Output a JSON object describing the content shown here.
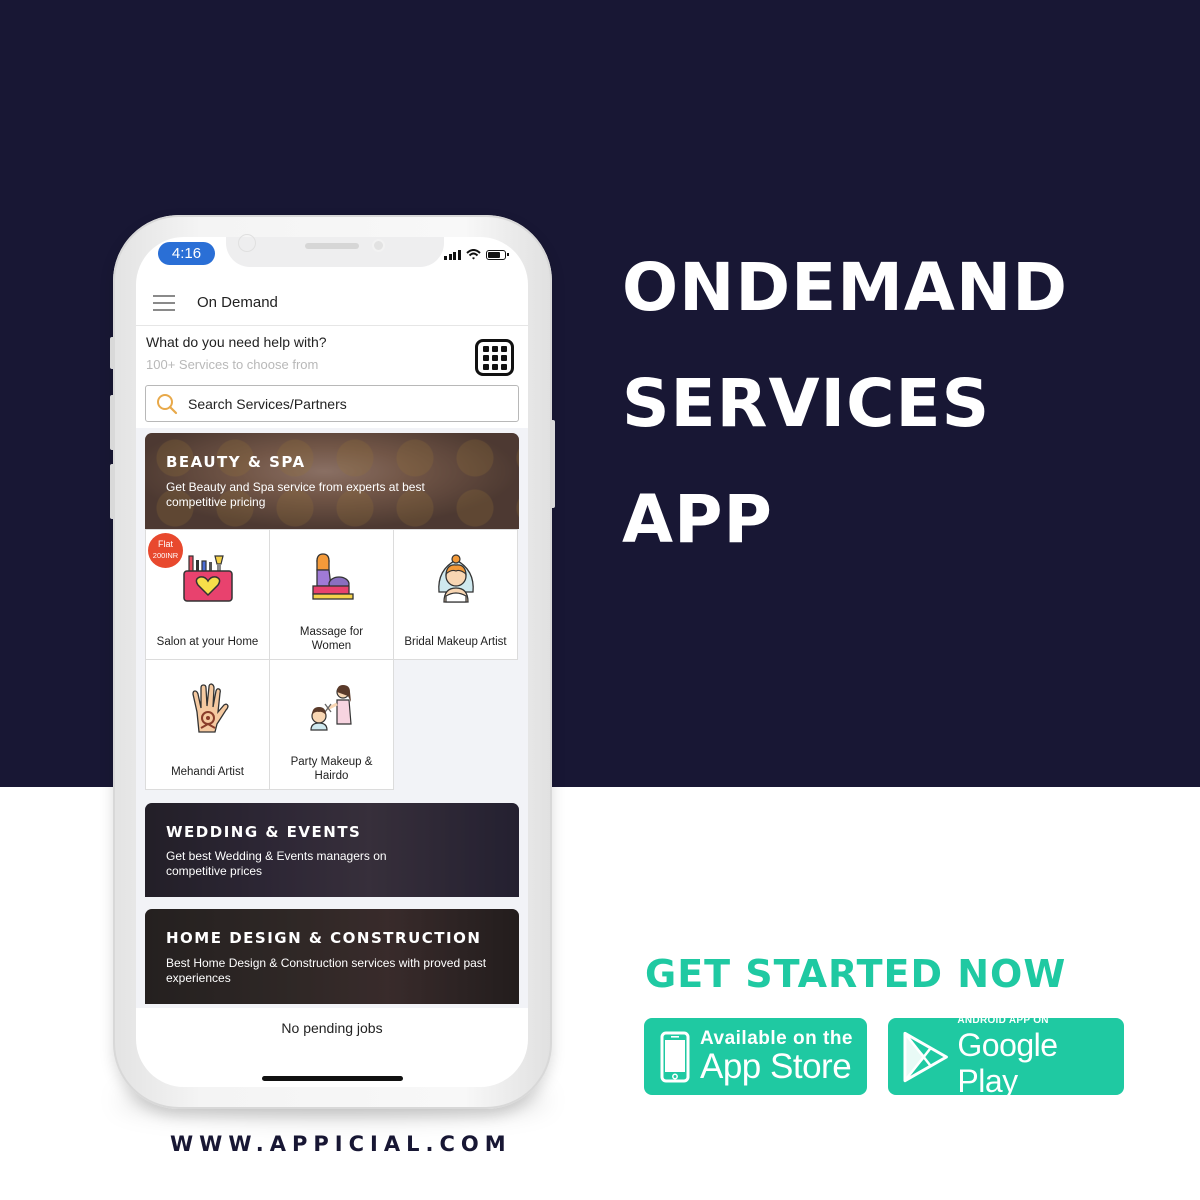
{
  "poster": {
    "headline": [
      "ONDEMAND",
      "SERVICES",
      "APP"
    ],
    "cta": "GET STARTED NOW",
    "website": "WWW.APPICIAL.COM",
    "colors": {
      "navy": "#181734",
      "accent": "#1fc9a2"
    },
    "store_buttons": {
      "app_store": {
        "small": "Available on the",
        "big": "App Store",
        "icon": "phone-icon"
      },
      "google_play": {
        "small": "ANDROID APP ON",
        "big": "Google Play",
        "icon": "play-triangle-icon"
      }
    }
  },
  "phone": {
    "status_bar": {
      "time": "4:16",
      "icons": [
        "signal-icon",
        "wifi-icon",
        "battery-icon"
      ]
    },
    "header": {
      "title": "On Demand",
      "menu_icon": "hamburger-icon"
    },
    "help": {
      "title": "What do you need help with?",
      "subtitle": "100+ Services to choose from",
      "grid_icon": "grid-icon"
    },
    "search": {
      "placeholder": "Search Services/Partners",
      "value": ""
    },
    "categories": [
      {
        "title": "BEAUTY & SPA",
        "description": "Get Beauty and Spa service from experts at best competitive pricing",
        "services": [
          {
            "label": "Salon at your Home",
            "icon": "makeup-bag-icon",
            "badge": [
              "Flat",
              "200INR"
            ]
          },
          {
            "label": "Massage for Women",
            "icon": "massage-icon"
          },
          {
            "label": "Bridal Makeup Artist",
            "icon": "bride-icon"
          },
          {
            "label": "Mehandi Artist",
            "icon": "henna-hand-icon"
          },
          {
            "label": "Party Makeup & Hairdo",
            "icon": "hairdresser-icon"
          }
        ]
      },
      {
        "title": "WEDDING & EVENTS",
        "description": "Get best Wedding & Events managers on competitive prices"
      },
      {
        "title": "HOME DESIGN & CONSTRUCTION",
        "description": "Best Home Design & Construction services with proved past experiences"
      }
    ],
    "footer_text": "No pending jobs"
  }
}
